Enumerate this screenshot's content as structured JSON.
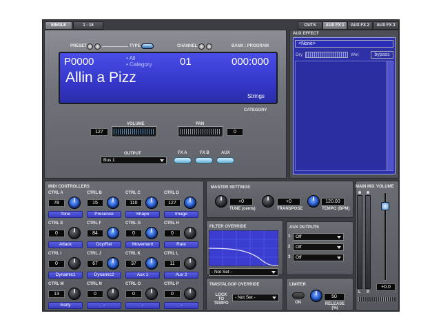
{
  "tabs": {
    "single": "SINGLE",
    "range": "1 - 16"
  },
  "aux_tabs": [
    "OUTS",
    "AUX FX 1",
    "AUX FX 2",
    "AUX FX 3"
  ],
  "header": {
    "preset": "PRESET",
    "type": "TYPE",
    "channel": "CHANNEL",
    "bank_program": "BANK : PROGRAM",
    "category_label": "CATEGORY"
  },
  "display": {
    "preset_code": "P0000",
    "filter_all": "• All",
    "filter_category": "• Category",
    "channel": "01",
    "bank_program": "000:000",
    "name": "Allin a Pizz",
    "category": "Strings"
  },
  "volume": {
    "label": "VOLUME",
    "value": "127"
  },
  "pan": {
    "label": "PAN",
    "value": "0"
  },
  "output": {
    "label": "OUTPUT",
    "value": "Bus 1"
  },
  "fx_buttons": [
    "FX A",
    "FX B",
    "AUX"
  ],
  "aux_effect": {
    "label": "AUX EFFECT",
    "selected": "<None>",
    "dry": "Dry",
    "wet": "Wet",
    "bypass": "bypass"
  },
  "midi": {
    "label": "MIDI CONTROLLERS",
    "controls": [
      {
        "ctrl": "CTRL A",
        "value": "78",
        "name": "Tone"
      },
      {
        "ctrl": "CTRL B",
        "value": "15",
        "name": "Presence"
      },
      {
        "ctrl": "CTRL C",
        "value": "110",
        "name": "Shape"
      },
      {
        "ctrl": "CTRL D",
        "value": "127",
        "name": "Image"
      },
      {
        "ctrl": "CTRL E",
        "value": "0",
        "name": "Attack"
      },
      {
        "ctrl": "CTRL F",
        "value": "84",
        "name": "Dcy/Rel"
      },
      {
        "ctrl": "CTRL G",
        "value": "0",
        "name": "Movement"
      },
      {
        "ctrl": "CTRL H",
        "value": "0",
        "name": "Rate"
      },
      {
        "ctrl": "CTRL I",
        "value": "0",
        "name": "Dynamic1"
      },
      {
        "ctrl": "CTRL J",
        "value": "67",
        "name": "Dynamic2"
      },
      {
        "ctrl": "CTRL K",
        "value": "37",
        "name": "Aux 1"
      },
      {
        "ctrl": "CTRL L",
        "value": "11",
        "name": "Aux 2"
      },
      {
        "ctrl": "CTRL M",
        "value": "13",
        "name": "Early"
      },
      {
        "ctrl": "CTRL N",
        "value": "0",
        "name": "-"
      },
      {
        "ctrl": "CTRL O",
        "value": "0",
        "name": "-"
      },
      {
        "ctrl": "CTRL P",
        "value": "0",
        "name": "-"
      }
    ]
  },
  "master": {
    "label": "MASTER SETTINGS",
    "tune_value": "+0",
    "tune_label": "TUNE (cents)",
    "transpose_value": "+0",
    "transpose_label": "TRANSPOSE",
    "tempo_value": "120.00",
    "tempo_label": "TEMPO (BPM)"
  },
  "filter": {
    "label": "FILTER OVERRIDE",
    "value": "- Not Set -"
  },
  "twistaloop": {
    "label": "TWISTALOOP OVERRIDE",
    "lock_label": "LOCK TO TEMPO",
    "value": "- Not Set -"
  },
  "aux_outputs": {
    "label": "AUX OUTPUTS",
    "items": [
      {
        "n": "1",
        "value": "Off"
      },
      {
        "n": "2",
        "value": "Off"
      },
      {
        "n": "3",
        "value": "Off"
      }
    ]
  },
  "limiter": {
    "label": "LIMITER",
    "on": "ON",
    "release_value": "50",
    "release_label": "RELEASE (%)"
  },
  "main_mix": {
    "label": "MAIN MIX",
    "volume_label": "VOLUME",
    "left": "L",
    "right": "R",
    "value": "+0.0"
  }
}
